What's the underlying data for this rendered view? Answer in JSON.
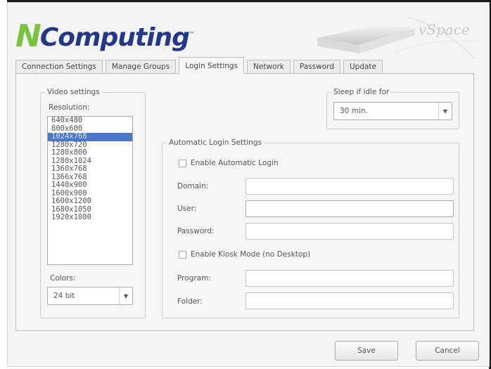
{
  "logo": {
    "n": "N",
    "rest": "Computing",
    "tm": "™"
  },
  "vspace": {
    "text": "vSpace"
  },
  "tabs": [
    {
      "label": "Connection Settings"
    },
    {
      "label": "Manage Groups"
    },
    {
      "label": "Login Settings",
      "active": true
    },
    {
      "label": "Network"
    },
    {
      "label": "Password"
    },
    {
      "label": "Update"
    }
  ],
  "video": {
    "legend": "Video settings",
    "resolution_label": "Resolution:",
    "resolutions": [
      "640x480",
      "800x600",
      "1024x768",
      "1280x720",
      "1280x800",
      "1280x1024",
      "1360x768",
      "1366x768",
      "1440x900",
      "1600x900",
      "1600x1200",
      "1680x1050",
      "1920x1080"
    ],
    "selected_resolution": "1024x768",
    "colors_label": "Colors:",
    "colors_value": "24 bit"
  },
  "sleep": {
    "legend": "Sleep if idle for",
    "value": "30 min."
  },
  "auto_login": {
    "legend": "Automatic Login Settings",
    "enable_label": "Enable Automatic Login",
    "domain_label": "Domain:",
    "user_label": "User:",
    "password_label": "Password:",
    "kiosk_label": "Enable Kiosk Mode (no Desktop)",
    "program_label": "Program:",
    "folder_label": "Folder:"
  },
  "buttons": {
    "save": "Save",
    "cancel": "Cancel"
  },
  "colors": {
    "logo_green": "#7cc242",
    "logo_blue": "#24388a",
    "selection": "#4b77c8"
  }
}
